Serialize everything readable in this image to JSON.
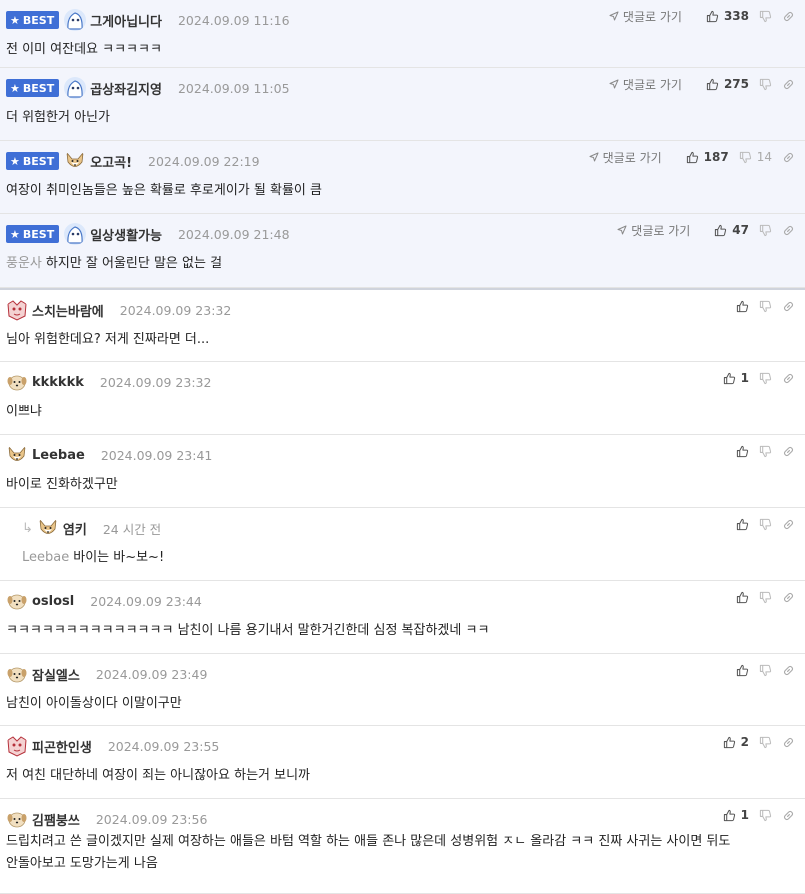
{
  "goto_label": "댓글로 가기",
  "best_label": "BEST",
  "best_comments": [
    {
      "nick": "그게아닙니다",
      "date": "2024.09.09 11:16",
      "up": "338",
      "down": "",
      "text": "전 이미 여잔데요 ㅋㅋㅋㅋㅋ",
      "avatar": "ghost-avatar"
    },
    {
      "nick": "곱상좌김지영",
      "date": "2024.09.09 11:05",
      "up": "275",
      "down": "",
      "text": "더 위험한거 아닌가",
      "avatar": "ghost-avatar"
    },
    {
      "nick": "오고곡!",
      "date": "2024.09.09 22:19",
      "up": "187",
      "down": "14",
      "text": "여장이 취미인놈들은 높은 확률로 후로게이가 될 확률이 큼",
      "avatar": "fox-avatar"
    },
    {
      "nick": "일상생활가능",
      "date": "2024.09.09 21:48",
      "up": "47",
      "down": "",
      "ref": "풍운사",
      "text": "하지만 잘 어울린단 말은 없는 걸",
      "avatar": "ghost-avatar"
    }
  ],
  "comments": [
    {
      "nick": "스치는바람에",
      "date": "2024.09.09 23:32",
      "up": "",
      "text": "님아 위험한데요? 저게 진짜라면 더...",
      "avatar": "red-avatar"
    },
    {
      "nick": "kkkkkk",
      "date": "2024.09.09 23:32",
      "up": "1",
      "text": "이쁘냐",
      "avatar": "dog-avatar"
    },
    {
      "nick": "Leebae",
      "date": "2024.09.09 23:41",
      "up": "",
      "text": "바이로 진화하겠구만",
      "avatar": "fox-avatar"
    },
    {
      "nick": "염키",
      "date": "24 시간 전",
      "up": "",
      "ref": "Leebae",
      "text": "바이는 바~보~!",
      "avatar": "fox-avatar",
      "reply": true
    },
    {
      "nick": "oslosl",
      "date": "2024.09.09 23:44",
      "up": "",
      "text": "ㅋㅋㅋㅋㅋㅋㅋㅋㅋㅋㅋㅋㅋㅋ 남친이 나름 용기내서 말한거긴한데 심정 복잡하겠네 ㅋㅋ",
      "avatar": "dog-avatar"
    },
    {
      "nick": "잠실엘스",
      "date": "2024.09.09 23:49",
      "up": "",
      "text": "남친이 아이돌상이다 이말이구만",
      "avatar": "dog-avatar"
    },
    {
      "nick": "피곤한인생",
      "date": "2024.09.09 23:55",
      "up": "2",
      "text": "저 여친 대단하네 여장이 죄는 아니잖아요 하는거 보니까",
      "avatar": "red-avatar"
    },
    {
      "nick": "김팸붕쓰",
      "date": "2024.09.09 23:56",
      "up": "1",
      "text": "드립치려고 쓴 글이겠지만 실제 여장하는 애들은 바텀 역할 하는 애들 존나 많은데 성병위험 ㅈㄴ 올라감 ㅋㅋ 진짜 사귀는 사이면 뒤도",
      "text2": "안돌아보고 도망가는게 나음",
      "avatar": "dog-avatar"
    }
  ],
  "icons": {
    "up": "thumbs-up-icon",
    "down": "thumbs-down-icon",
    "link": "link-icon",
    "goto": "arrow-icon",
    "star": "star-icon",
    "reply": "reply-arrow-icon"
  },
  "colors": {
    "best_bg": "#f3f5fc",
    "badge": "#3f6fd6",
    "date": "#999999"
  }
}
